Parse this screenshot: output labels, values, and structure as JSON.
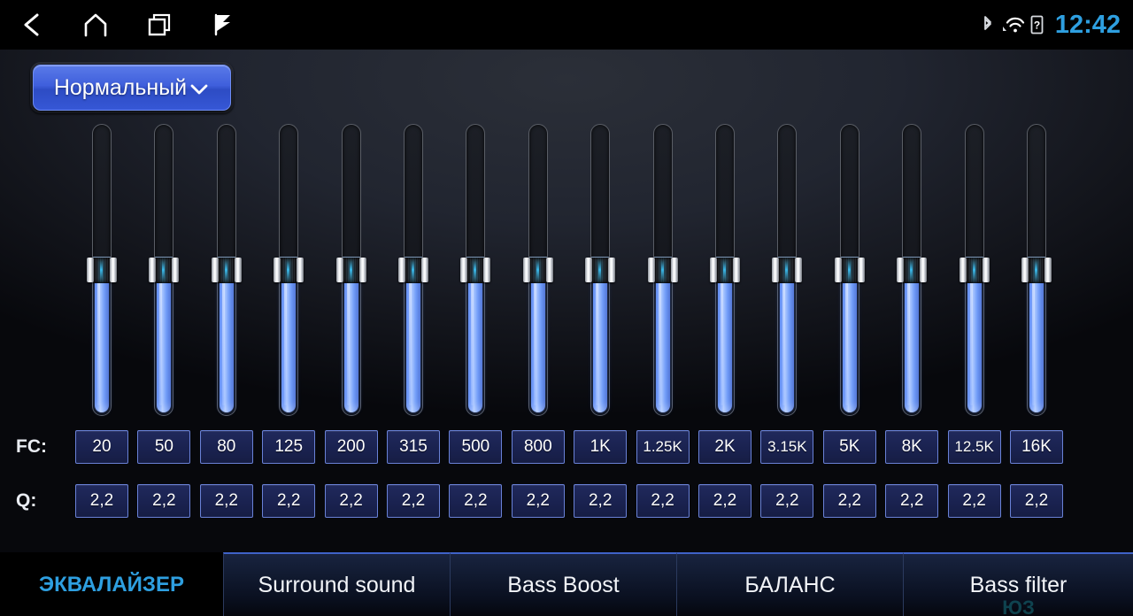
{
  "statusbar": {
    "nav": [
      {
        "name": "back-icon",
        "label": "back"
      },
      {
        "name": "home-icon",
        "label": "home"
      },
      {
        "name": "recents-icon",
        "label": "recents"
      },
      {
        "name": "flag-icon",
        "label": "flag"
      }
    ],
    "icons": [
      {
        "name": "bluetooth-icon",
        "label": "bluetooth"
      },
      {
        "name": "wifi-icon",
        "label": "wifi"
      },
      {
        "name": "sim-unknown-icon",
        "label": "?"
      }
    ],
    "clock": "12:42",
    "clock_color": "#2e9fe0"
  },
  "preset": {
    "label": "Нормальный",
    "chevron": "chevron-down-icon",
    "accent": "#3f5fdc"
  },
  "equalizer": {
    "band_count": 16,
    "fc_row_label": "FC:",
    "q_row_label": "Q:",
    "bands": [
      {
        "fc": "20",
        "q": "2,2",
        "level": 50
      },
      {
        "fc": "50",
        "q": "2,2",
        "level": 50
      },
      {
        "fc": "80",
        "q": "2,2",
        "level": 50
      },
      {
        "fc": "125",
        "q": "2,2",
        "level": 50
      },
      {
        "fc": "200",
        "q": "2,2",
        "level": 50
      },
      {
        "fc": "315",
        "q": "2,2",
        "level": 50
      },
      {
        "fc": "500",
        "q": "2,2",
        "level": 50
      },
      {
        "fc": "800",
        "q": "2,2",
        "level": 50
      },
      {
        "fc": "1K",
        "q": "2,2",
        "level": 50
      },
      {
        "fc": "1.25K",
        "q": "2,2",
        "level": 50
      },
      {
        "fc": "2K",
        "q": "2,2",
        "level": 50
      },
      {
        "fc": "3.15K",
        "q": "2,2",
        "level": 50
      },
      {
        "fc": "5K",
        "q": "2,2",
        "level": 50
      },
      {
        "fc": "8K",
        "q": "2,2",
        "level": 50
      },
      {
        "fc": "12.5K",
        "q": "2,2",
        "level": 50
      },
      {
        "fc": "16K",
        "q": "2,2",
        "level": 50
      }
    ]
  },
  "tabs": [
    {
      "label": "ЭКВАЛАЙЗЕР",
      "active": true
    },
    {
      "label": "Surround sound",
      "active": false
    },
    {
      "label": "Bass Boost",
      "active": false
    },
    {
      "label": "БАЛАНС",
      "active": false
    },
    {
      "label": "Bass filter",
      "active": false
    }
  ],
  "watermark": "ЮЗ"
}
